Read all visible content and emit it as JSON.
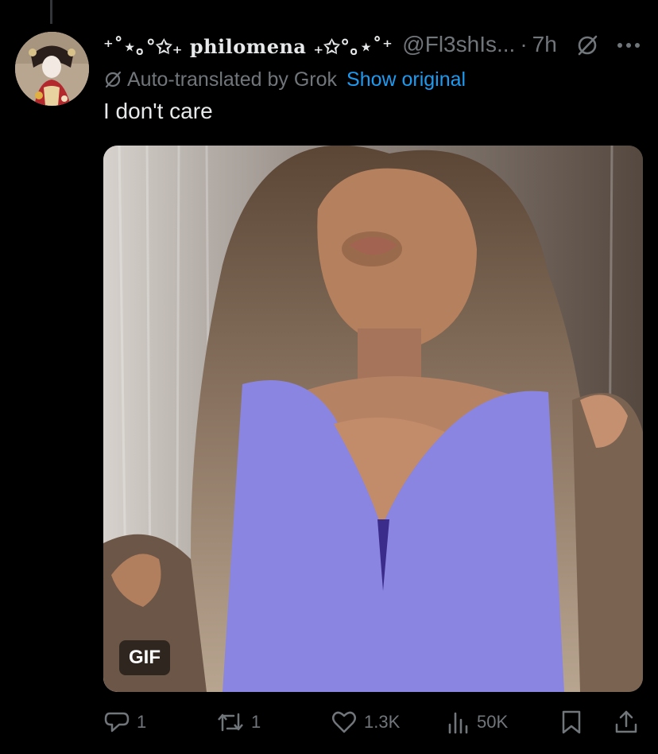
{
  "tweet": {
    "display_name": "⁺˚⋆｡°✩₊ philomena ₊✩°｡⋆˚⁺",
    "handle": "@Fl3shIs...",
    "separator": "·",
    "time": "7h",
    "translation_notice": "Auto-translated by Grok",
    "show_original_label": "Show original",
    "text": "I don't care",
    "media_badge": "GIF"
  },
  "actions": {
    "replies": "1",
    "reposts": "1",
    "likes": "1.3K",
    "views": "50K"
  },
  "icons": {
    "reply": "reply-icon",
    "repost": "repost-icon",
    "like": "heart-icon",
    "views": "views-icon",
    "bookmark": "bookmark-icon",
    "share": "share-icon",
    "more": "more-icon",
    "grok": "grok-icon"
  },
  "colors": {
    "background": "#000000",
    "text": "#e7e9ea",
    "muted": "#71767b",
    "link": "#1d9bf0"
  }
}
